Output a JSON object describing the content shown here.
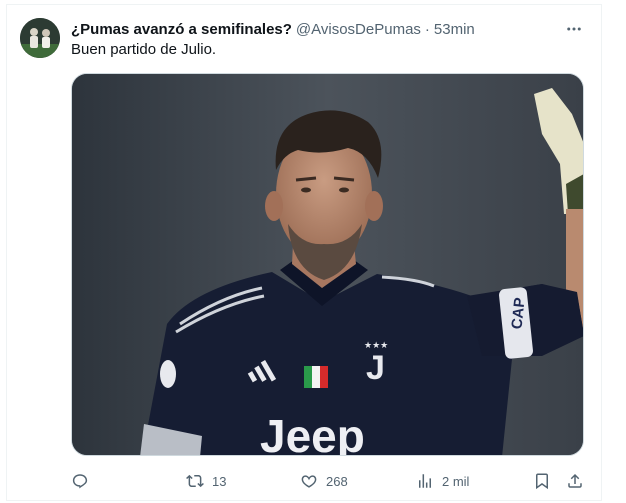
{
  "tweet": {
    "display_name": "¿Pumas avanzó a semifinales?",
    "handle": "@AvisosDePumas",
    "separator": "·",
    "time": "53min",
    "text": "Buen partido de Julio."
  },
  "media": {
    "kit_sponsor": "Jeep",
    "armband_text": "CAP",
    "badge_text": "J"
  },
  "actions": {
    "replies": "",
    "retweets": "13",
    "likes": "268",
    "views": "2 mil"
  },
  "colors": {
    "text_primary": "#0f1419",
    "text_secondary": "#536471",
    "border": "#cfd9de"
  },
  "icons": [
    "more-icon",
    "reply-icon",
    "retweet-icon",
    "like-icon",
    "views-icon",
    "bookmark-icon",
    "share-icon"
  ]
}
